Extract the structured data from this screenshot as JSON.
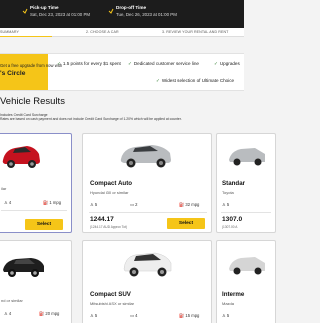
{
  "header": {
    "pickup_label": "Pick-up Time",
    "pickup_value": "Sat, Dec 23, 2023 at 01:00 PM",
    "dropoff_label": "Drop-off Time",
    "dropoff_value": "Tue, Dec 26, 2023 at 01:00 PM"
  },
  "steps": {
    "step1": "SUMMARY",
    "step2": "2. CHOOSE A CAR",
    "step3": "3. REVIEW YOUR RENTAL AND RENT"
  },
  "promo": {
    "line1": "Get a free upgrade from now with",
    "line2": "'s Circle",
    "benefits": [
      "1.5 points for every $1 spent",
      "Dedicated customer service line",
      "Upgrades",
      "Widest selection of Ultimate Choice"
    ]
  },
  "results": {
    "title": "Vehicle Results",
    "note1": "Includes Credit Card Surcharge",
    "note2": "Rates are based on cash payment and does not include Credit Card Surcharge of 1.20% which will be applied at counter."
  },
  "cards": [
    {
      "title": "",
      "subtitle": "ilar",
      "passengers": "4",
      "bags": "",
      "mpg": "1 mpg",
      "price": "",
      "price_note": "",
      "select_label": "Select",
      "car_color": "#c5121f"
    },
    {
      "title": "Compact Auto",
      "subtitle": "Hyundai i30 or similar",
      "passengers": "5",
      "bags": "2",
      "mpg": "32 mpg",
      "price": "1244.17",
      "price_note": "(1244.17 AUD Approx Tot)",
      "select_label": "Select",
      "car_color": "#b9bcbf"
    },
    {
      "title": "Standar",
      "subtitle": "Toyota",
      "passengers": "5",
      "bags": "",
      "mpg": "",
      "price": "1307.0",
      "price_note": "(1307.00 A",
      "select_label": "",
      "car_color": "#b9bcbf"
    },
    {
      "title": "",
      "subtitle": "nd or similar",
      "passengers": "4",
      "bags": "",
      "mpg": "20 mpg",
      "price": "",
      "price_note": "",
      "select_label": "",
      "car_color": "#1e1e1e"
    },
    {
      "title": "Compact SUV",
      "subtitle": "Mitsubishi ASX or similar",
      "passengers": "5",
      "bags": "4",
      "mpg": "15 mpg",
      "price": "",
      "price_note": "",
      "select_label": "",
      "car_color": "#eeeeee"
    },
    {
      "title": "Interme",
      "subtitle": "Mazda",
      "passengers": "5",
      "bags": "",
      "mpg": "",
      "price": "",
      "price_note": "",
      "select_label": "",
      "car_color": "#d5d5d5"
    }
  ]
}
